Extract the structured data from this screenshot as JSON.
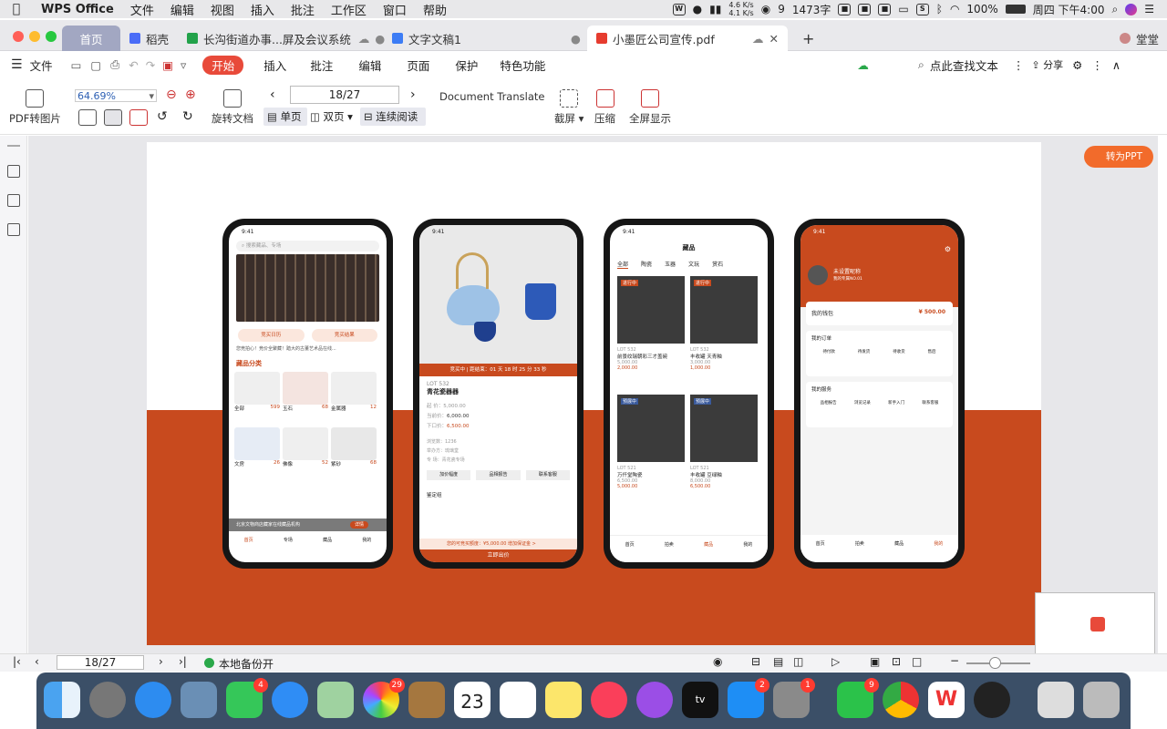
{
  "menubar": {
    "app": "WPS Office",
    "items": [
      "文件",
      "编辑",
      "视图",
      "插入",
      "批注",
      "工作区",
      "窗口",
      "帮助"
    ],
    "net_up": "4.6 K/s",
    "net_down": "4.1 K/s",
    "wechat_count": "9",
    "word_count": "1473字",
    "battery": "100%",
    "clock": "周四 下午4:00"
  },
  "tabs": {
    "home": "首页",
    "docer": "稻壳",
    "sheet": "长沟街道办事...屏及会议系统",
    "doc": "文字文稿1",
    "pdf": "小墨匠公司宣传.pdf",
    "user": "堂堂"
  },
  "toolbar": {
    "file": "文件",
    "ribbon": [
      "开始",
      "插入",
      "批注",
      "编辑",
      "页面",
      "保护",
      "特色功能"
    ],
    "search": "点此查找文本",
    "share": "分享"
  },
  "tools": {
    "pdf_to_img": "PDF转图片",
    "zoom": "64.69%",
    "rotate": "旋转文档",
    "page_input": "18/27",
    "translate": "Document Translate",
    "single": "单页",
    "double": "双页",
    "continuous": "连续阅读",
    "screenshot": "截屏",
    "compress": "压缩",
    "fullscreen": "全屏显示"
  },
  "convert_ppt": "转为PPT",
  "statusbar": {
    "page": "18/27",
    "backup": "本地备份开"
  },
  "phones": {
    "p1": {
      "time": "9:41",
      "search": "搜索藏品、专场",
      "btn1": "竞买日历",
      "btn2": "竞买结果",
      "notice": "您竞拍心！竞价全聚藏！踏大的古董艺术品在线...",
      "section": "藏品分类",
      "cats": [
        {
          "name": "全部",
          "count": "599"
        },
        {
          "name": "玉石",
          "count": "68"
        },
        {
          "name": "金属器",
          "count": "12"
        },
        {
          "name": "文房",
          "count": "26"
        },
        {
          "name": "佛像",
          "count": "52"
        },
        {
          "name": "紫砂",
          "count": "68"
        }
      ],
      "banner": "北京文物商店藏家在线藏品机构",
      "banner_btn": "详情",
      "nav": [
        "首页",
        "专场",
        "藏品",
        "我的"
      ]
    },
    "p2": {
      "time": "9:41",
      "countdown": "竞买中 | 距结束：01 天 18 时 25 分 33 秒",
      "lot": "LOT 532",
      "name": "青花瓷器器",
      "price_label1": "起 价：",
      "price1": "5,000.00",
      "price_label2": "当前价：",
      "price2": "6,000.00",
      "price_label3": "下口价：",
      "price3": "6,500.00",
      "info1": "浏览数：1236",
      "info2": "举办方：琉璃堂",
      "info3": "专 场：青花瓷专场",
      "b1": "加价幅度",
      "b2": "品相报告",
      "b3": "联系客服",
      "appraisal": "鉴定组",
      "deposit": "您的可竞买额度：¥5,000.00",
      "deposit_btn": "增加保证金 >",
      "bid": "立即出价"
    },
    "p3": {
      "time": "9:41",
      "title": "藏品",
      "tabs": [
        "全部",
        "陶瓷",
        "玉器",
        "文玩",
        "赏石"
      ],
      "items": [
        {
          "tag": "进行中",
          "lot": "LOT 532",
          "name": "前景纹瑞朝彩三才盖碗",
          "p1": "5,000.00",
          "p2": "2,000.00"
        },
        {
          "tag": "进行中",
          "lot": "LOT 532",
          "name": "丰收罐 天青釉",
          "p1": "3,000.00",
          "p2": "1,000.00"
        },
        {
          "tag": "预展中",
          "lot": "LOT 521",
          "name": "万仟堂陶瓷",
          "p1": "6,500.00",
          "p2": "5,000.00"
        },
        {
          "tag": "预展中",
          "lot": "LOT 521",
          "name": "丰收罐 豆绿釉",
          "p1": "8,000.00",
          "p2": "6,500.00"
        }
      ],
      "nav": [
        "首页",
        "拍卖",
        "藏品",
        "我的"
      ]
    },
    "p4": {
      "time": "9:41",
      "nick": "未设置昵称",
      "sub": "我的专属NO.01",
      "wallet_label": "我的钱包",
      "wallet": "¥ 500.00",
      "orders": "我的订单",
      "order_items": [
        "待付款",
        "待发货",
        "待收货",
        "售后"
      ],
      "services": "我的服务",
      "service_items": [
        "品相报告",
        "浏览记录",
        "新手入门",
        "联系客服"
      ],
      "nav": [
        "首页",
        "拍卖",
        "藏品",
        "我的"
      ]
    }
  }
}
